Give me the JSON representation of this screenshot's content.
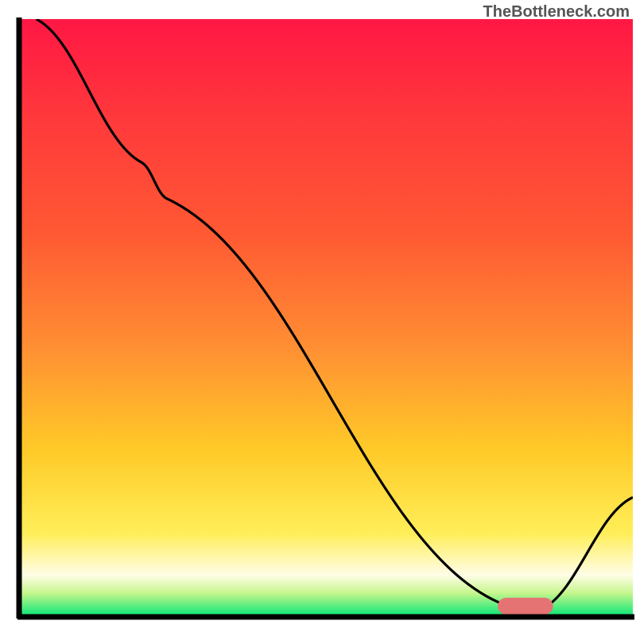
{
  "watermark": "TheBottleneck.com",
  "chart_data": {
    "type": "line",
    "title": "",
    "xlabel": "",
    "ylabel": "",
    "xlim": [
      0,
      100
    ],
    "ylim": [
      0,
      100
    ],
    "background_gradient": {
      "top": "#ff1744",
      "mid1": "#ff5933",
      "mid2": "#ff8f33",
      "mid3": "#ffca28",
      "mid4": "#ffee58",
      "mid5": "#fffde7",
      "bottom": "#00e676"
    },
    "series": [
      {
        "name": "bottleneck-curve",
        "color": "#000000",
        "points": [
          {
            "x": 2.8,
            "y": 100
          },
          {
            "x": 20,
            "y": 76
          },
          {
            "x": 24,
            "y": 70
          },
          {
            "x": 78,
            "y": 2.5
          },
          {
            "x": 80,
            "y": 1.2
          },
          {
            "x": 85,
            "y": 1.2
          },
          {
            "x": 100,
            "y": 20
          }
        ]
      }
    ],
    "marker": {
      "name": "optimal-range",
      "color": "#e57373",
      "x_start": 78,
      "x_end": 87,
      "y": 1.8,
      "thickness": 2.8
    },
    "axes": {
      "left_border": true,
      "bottom_border": true,
      "right_border": false,
      "top_border": false,
      "border_width": 6,
      "border_color": "#000000"
    }
  }
}
